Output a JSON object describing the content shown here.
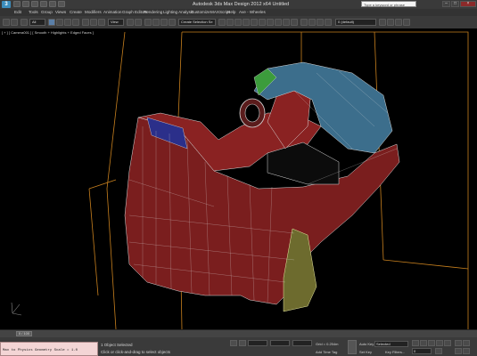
{
  "window": {
    "title": "Autodesk 3ds Max Design 2012 x64     Untitled",
    "search_placeholder": "Type a keyword or phrase",
    "min_glyph": "–",
    "max_glyph": "□",
    "close_glyph": "×",
    "logo": "3"
  },
  "menu": [
    "Edit",
    "Tools",
    "Group",
    "Views",
    "Create",
    "Modifiers",
    "Animation",
    "Graph Editors",
    "Rendering",
    "Lighting Analysis",
    "Customize",
    "MAXScript",
    "Help",
    "Ave - Wheeles"
  ],
  "toolbar": {
    "selection_filter": "All",
    "reference_coord": "View",
    "named_selection": "Create Selection Se",
    "layer_field": "0 (default)"
  },
  "viewport": {
    "label": "[ + ] [ Camera001 ] [ Smooth + Highlights + Edged Faces ]"
  },
  "timeline": {
    "slider_label": "0 / 100"
  },
  "status": {
    "maxscript_output": "Max to Physics Geometry Scale = 1.0",
    "selection_text": "1 Object Selected",
    "prompt_text": "Click or click-and-drag to select objects",
    "grid_text": "Grid = 0.254m",
    "add_time_tag": "Add Time Tag",
    "auto_key": "Auto Key",
    "set_key": "Set Key",
    "selected_dropdown": "Selected",
    "key_filters": "Key Filters...",
    "frame_field": "0"
  },
  "colors": {
    "viewport_bg": "#000000",
    "mesh_red": "#7a1e1e",
    "mesh_blue": "#3c6e8c",
    "mesh_yellow": "#6d6b2e",
    "mesh_green": "#3c9c3c",
    "bbox_orange": "#c8801e"
  }
}
